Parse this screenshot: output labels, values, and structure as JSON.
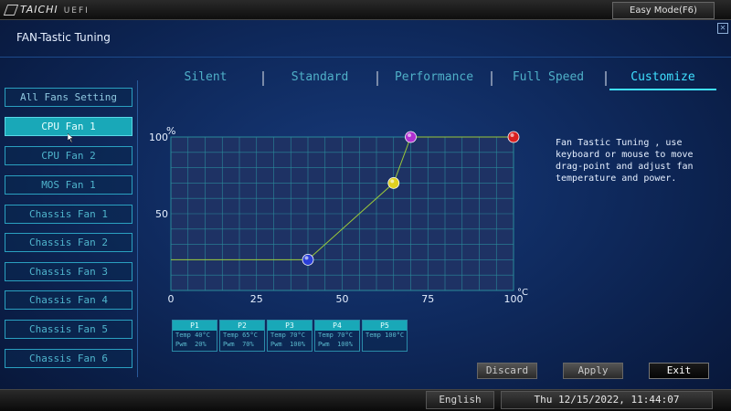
{
  "topbar": {
    "brand": "TAICHI",
    "brand_sub": "UEFI",
    "easy_mode_label": "Easy Mode(F6)"
  },
  "page": {
    "title": "FAN-Tastic Tuning",
    "close_icon": "close-icon"
  },
  "tabs": [
    {
      "label": "Silent",
      "active": false
    },
    {
      "label": "Standard",
      "active": false
    },
    {
      "label": "Performance",
      "active": false
    },
    {
      "label": "Full Speed",
      "active": false
    },
    {
      "label": "Customize",
      "active": true
    }
  ],
  "sidebar": {
    "items": [
      {
        "label": "All Fans Setting",
        "active": false
      },
      {
        "label": "CPU Fan 1",
        "active": true
      },
      {
        "label": "CPU Fan 2",
        "active": false
      },
      {
        "label": "MOS Fan 1",
        "active": false
      },
      {
        "label": "Chassis Fan 1",
        "active": false
      },
      {
        "label": "Chassis Fan 2",
        "active": false
      },
      {
        "label": "Chassis Fan 3",
        "active": false
      },
      {
        "label": "Chassis Fan 4",
        "active": false
      },
      {
        "label": "Chassis Fan 5",
        "active": false
      },
      {
        "label": "Chassis Fan 6",
        "active": false
      }
    ]
  },
  "chart_data": {
    "type": "line",
    "ylabel": "%",
    "xlabel": "°C",
    "xlim": [
      0,
      100
    ],
    "ylim": [
      0,
      100
    ],
    "x_ticks": [
      "0",
      "25",
      "50",
      "75",
      "100"
    ],
    "y_ticks": [
      "100",
      "50"
    ],
    "grid": true,
    "curve": [
      {
        "x": 0,
        "y": 20
      },
      {
        "x": 40,
        "y": 20
      },
      {
        "x": 65,
        "y": 70
      },
      {
        "x": 70,
        "y": 100
      },
      {
        "x": 100,
        "y": 100
      }
    ],
    "points": [
      {
        "name": "P1",
        "temp": 40,
        "pwm": 20,
        "color": "#2a3fd8"
      },
      {
        "name": "P2",
        "temp": 65,
        "pwm": 70,
        "color": "#e0d020"
      },
      {
        "name": "P3",
        "temp": 70,
        "pwm": 100,
        "color": "#b030d0"
      },
      {
        "name": "P4",
        "temp": 70,
        "pwm": 100,
        "color": "#b030d0"
      },
      {
        "name": "P5",
        "temp": 100,
        "pwm": 100,
        "color": "#d82020"
      }
    ],
    "line_color": "#9ac83a",
    "grid_color": "#2a8a9a"
  },
  "description": "Fan Tastic Tuning , use keyboard or mouse to move drag-point and adjust fan temperature and power.",
  "point_table": [
    {
      "label": "P1",
      "temp": "Temp 40°C",
      "pwm": "Pwm  20%"
    },
    {
      "label": "P2",
      "temp": "Temp 65°C",
      "pwm": "Pwm  70%"
    },
    {
      "label": "P3",
      "temp": "Temp 70°C",
      "pwm": "Pwm  100%"
    },
    {
      "label": "P4",
      "temp": "Temp 70°C",
      "pwm": "Pwm  100%"
    },
    {
      "label": "P5",
      "temp": "Temp 100°C",
      "pwm": ""
    }
  ],
  "actions": {
    "discard": "Discard",
    "apply": "Apply",
    "exit": "Exit"
  },
  "footer": {
    "language": "English",
    "datetime": "Thu 12/15/2022, 11:44:07"
  },
  "colors": {
    "accent": "#19a8b8",
    "tab_text": "#4fb0c8",
    "active_underline": "#3fe0ff"
  }
}
